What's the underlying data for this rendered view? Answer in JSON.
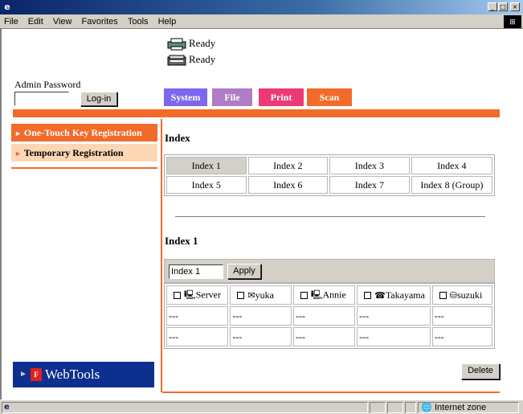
{
  "window": {
    "minimize_glyph": "_",
    "maximize_glyph": "□",
    "close_glyph": "×"
  },
  "menu": [
    "File",
    "Edit",
    "View",
    "Favorites",
    "Tools",
    "Help"
  ],
  "status": {
    "printer_status": "Ready",
    "scanner_status": "Ready"
  },
  "admin": {
    "label": "Admin Password",
    "password_value": "",
    "login_label": "Log-in"
  },
  "tabs": [
    {
      "label": "System",
      "color": "#7b68ee"
    },
    {
      "label": "File",
      "color": "#b07cc6"
    },
    {
      "label": "Print",
      "color": "#ee3a73"
    },
    {
      "label": "Scan",
      "color": "#f26b2a"
    }
  ],
  "sidebar": {
    "items": [
      {
        "label": "One-Touch Key Registration",
        "arrow": "►"
      },
      {
        "label": "Temporary Registration",
        "arrow": "►"
      }
    ],
    "webtools": {
      "label": "WebTools",
      "arrow": "►"
    }
  },
  "index_section": {
    "title": "Index",
    "cells": [
      "Index 1",
      "Index 2",
      "Index 3",
      "Index 4",
      "Index 5",
      "Index 6",
      "Index 7",
      "Index 8 (Group)"
    ],
    "selected": "Index 1"
  },
  "index1_section": {
    "title": "Index 1",
    "input_value": "Index 1",
    "apply_label": "Apply",
    "destinations": [
      {
        "name": "Server",
        "icon": "computer-icon"
      },
      {
        "name": "yuka",
        "icon": "email-icon"
      },
      {
        "name": "Annie",
        "icon": "computer-icon"
      },
      {
        "name": "Takayama",
        "icon": "fax-icon"
      },
      {
        "name": "suzuki",
        "icon": "database-icon"
      }
    ],
    "empty_rows": [
      [
        "---",
        "---",
        "---",
        "---",
        "---"
      ],
      [
        "---",
        "---",
        "---",
        "---",
        "---"
      ]
    ],
    "delete_label": "Delete"
  },
  "statusbar": {
    "zone": "Internet zone"
  },
  "colors": {
    "accent_orange": "#f26b2a",
    "side_light": "#fbd7b5",
    "webtools_blue": "#0d2f8f"
  }
}
